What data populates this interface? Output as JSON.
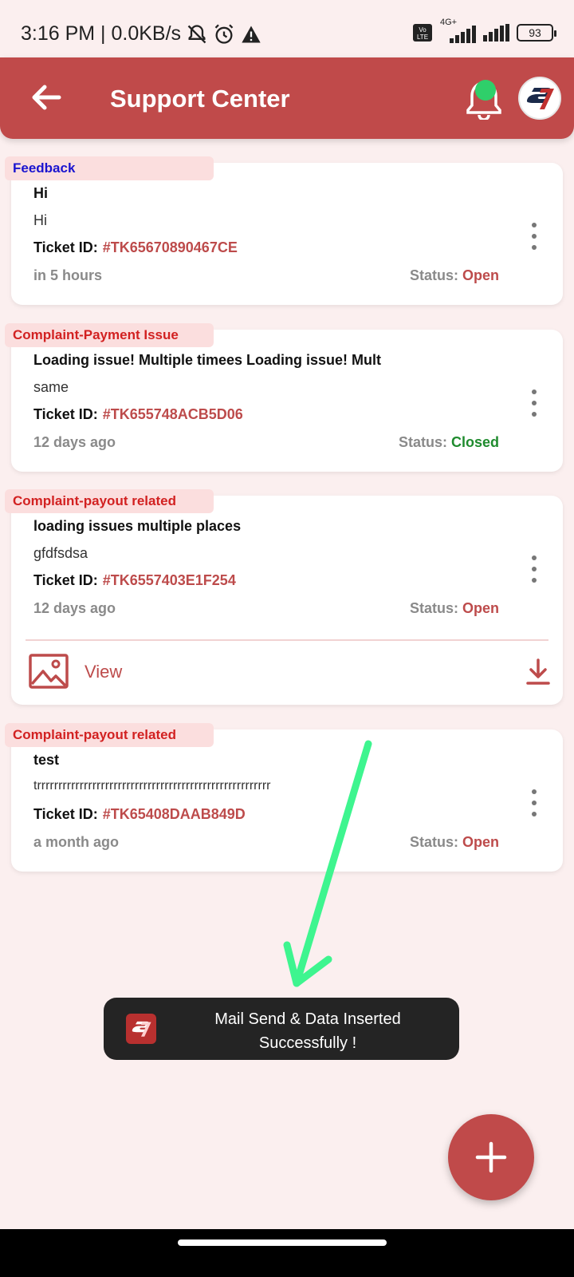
{
  "status_bar": {
    "time_speed": "3:16 PM | 0.0KB/s",
    "network": "4G+",
    "battery": "93",
    "icons": [
      "mute-bell-icon",
      "alarm-icon",
      "warning-icon",
      "volte-icon",
      "signal-icon",
      "battery-icon"
    ]
  },
  "header": {
    "title": "Support Center",
    "icons": [
      "back-arrow-icon",
      "notification-bell-icon",
      "app-logo-avatar"
    ]
  },
  "tickets": [
    {
      "category": "Feedback",
      "title": "Hi",
      "description": "Hi",
      "ticket_label": "Ticket ID:",
      "ticket_id": "#TK65670890467CE",
      "time": "in 5 hours",
      "status_label": "Status:",
      "status": "Open"
    },
    {
      "category": "Complaint-Payment Issue",
      "title": "Loading issue! Multiple timees Loading issue! Mult",
      "description": "same",
      "ticket_label": "Ticket ID:",
      "ticket_id": "#TK655748ACB5D06",
      "time": "12 days ago",
      "status_label": "Status:",
      "status": "Closed"
    },
    {
      "category": "Complaint-payout related",
      "title": "loading issues multiple places",
      "description": "gfdfsdsa",
      "ticket_label": "Ticket ID:",
      "ticket_id": "#TK6557403E1F254",
      "time": "12 days ago",
      "status_label": "Status:",
      "status": "Open",
      "attachment_label": "View"
    },
    {
      "category": "Complaint-payout related",
      "title": "test",
      "description": "trrrrrrrrrrrrrrrrrrrrrrrrrrrrrrrrrrrrrrrrrrrrrrrrrrrrrrr",
      "ticket_label": "Ticket ID:",
      "ticket_id": "#TK65408DAAB849D",
      "time": "a month ago",
      "status_label": "Status:",
      "status": "Open"
    }
  ],
  "toast": {
    "line1": "Mail Send & Data Inserted",
    "line2": "Successfully !"
  },
  "colors": {
    "primary": "#c04a4a",
    "background": "#fbefef",
    "open": "#bd4b4b",
    "closed": "#1f8b2e",
    "annotation_arrow": "#3ef58f"
  }
}
